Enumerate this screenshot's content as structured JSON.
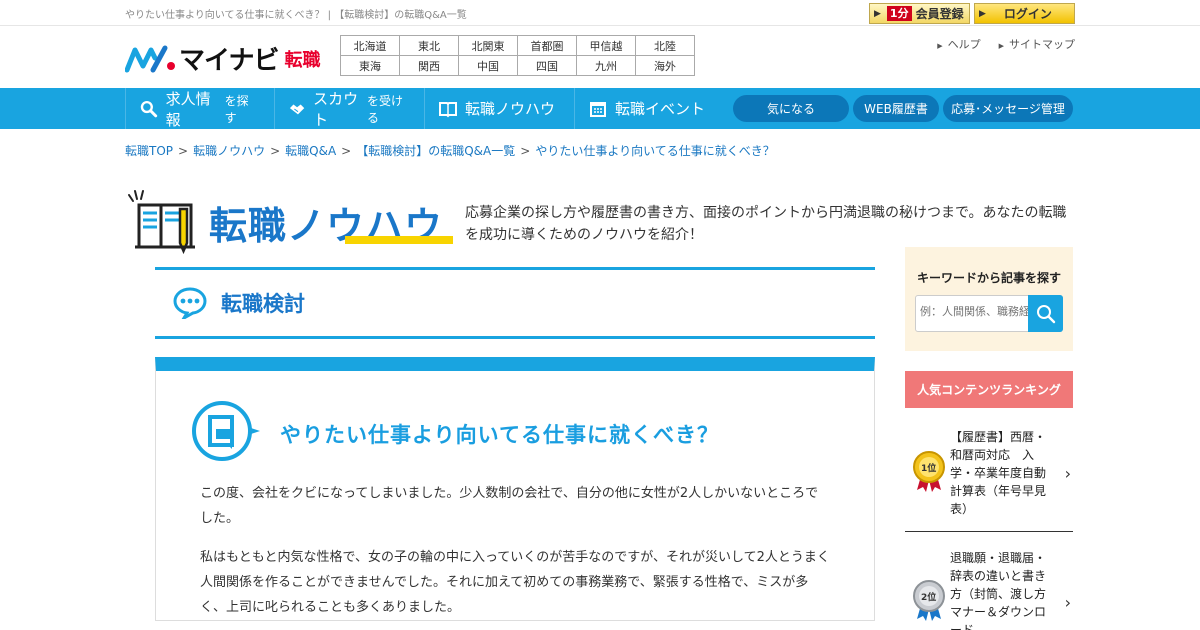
{
  "topbar": {
    "description": "やりたい仕事より向いてる仕事に就くべき？ | 【転職検討】の転職Q&A一覧",
    "member_badge": "1分",
    "member_label": "会員登録",
    "login_label": "ログイン"
  },
  "logo": {
    "brand": "マイナビ",
    "tenshoku": "転職"
  },
  "regions": [
    [
      "北海道",
      "東北",
      "北関東",
      "首都圏",
      "甲信越",
      "北陸"
    ],
    [
      "東海",
      "関西",
      "中国",
      "四国",
      "九州",
      "海外"
    ]
  ],
  "header_links": {
    "help": "ヘルプ",
    "sitemap": "サイトマップ"
  },
  "nav": {
    "items": [
      {
        "main": "求人情報",
        "small": "を探す",
        "icon": "search-icon"
      },
      {
        "main": "スカウト",
        "small": "を受ける",
        "icon": "handshake-icon"
      },
      {
        "main": "転職ノウハウ",
        "small": "",
        "icon": "book-icon"
      },
      {
        "main": "転職イベント",
        "small": "",
        "icon": "calendar-icon"
      }
    ],
    "pills": [
      "気になる",
      "WEB履歴書",
      "応募･メッセージ管理"
    ]
  },
  "breadcrumb": [
    "転職TOP",
    "転職ノウハウ",
    "転職Q&A",
    "【転職検討】の転職Q&A一覧",
    "やりたい仕事より向いてる仕事に就くべき？"
  ],
  "section": {
    "title": "転職ノウハウ",
    "lead": "応募企業の探し方や履歴書の書き方、面接のポイントから円満退職の秘けつまで。あなたの転職を成功に導くためのノウハウを紹介！"
  },
  "category": {
    "name": "転職検討"
  },
  "article": {
    "title": "やりたい仕事より向いてる仕事に就くべき？",
    "paragraphs": [
      "この度、会社をクビになってしまいました。少人数制の会社で、自分の他に女性が2人しかいないところでした。",
      "私はもともと内気な性格で、女の子の輪の中に入っていくのが苦手なのですが、それが災いして2人とうまく人間関係を作ることができませんでした。それに加えて初めての事務業務で、緊張する性格で、ミスが多く、上司に叱られることも多くありました。"
    ]
  },
  "sidebar": {
    "search_title": "キーワードから記事を探す",
    "search_placeholder": "例：人間関係、職務経歴書",
    "ranking_title": "人気コンテンツランキング",
    "ranking": [
      {
        "rank": "1位",
        "text": "【履歴書】西暦・和暦両対応　入学・卒業年度自動計算表（年号早見表）"
      },
      {
        "rank": "2位",
        "text": "退職願・退職届・辞表の違いと書き方（封筒、渡し方マナー＆ダウンロード"
      }
    ]
  },
  "colors": {
    "accent": "#19a4e0",
    "title_blue": "#1a77c9",
    "brand_red": "#e8002d",
    "ranking_bg": "#f07878",
    "search_bg": "#fdf3df"
  }
}
